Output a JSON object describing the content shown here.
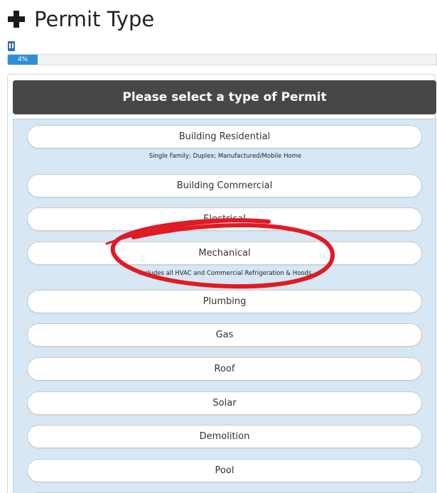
{
  "header": {
    "title": "Permit Type"
  },
  "progress": {
    "label": "4%",
    "fraction": 0.07
  },
  "panel": {
    "heading": "Please select a type of Permit"
  },
  "permits": [
    {
      "label": "Building Residential",
      "description": "Single Family; Duplex; Manufactured/Mobile Home"
    },
    {
      "label": "Building Commercial"
    },
    {
      "label": "Electrical"
    },
    {
      "label": "Mechanical",
      "description": "Includes all HVAC and Commercial Refrigeration & Hoods"
    },
    {
      "label": "Plumbing"
    },
    {
      "label": "Gas"
    },
    {
      "label": "Roof"
    },
    {
      "label": "Solar"
    },
    {
      "label": "Demolition"
    },
    {
      "label": "Pool"
    }
  ],
  "annotation": {
    "color": "#e01b24",
    "target": "Mechanical"
  }
}
